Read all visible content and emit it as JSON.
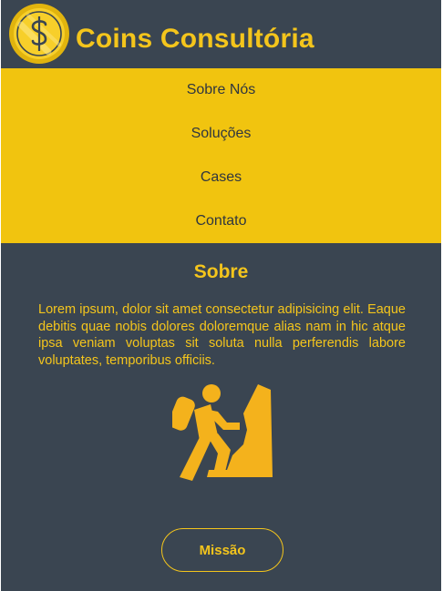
{
  "brand": {
    "name": "Coins Consultória",
    "logo_icon": "dollar-coin-icon"
  },
  "nav": {
    "items": [
      {
        "label": "Sobre Nós"
      },
      {
        "label": "Soluções"
      },
      {
        "label": "Cases"
      },
      {
        "label": "Contato"
      }
    ]
  },
  "about": {
    "title": "Sobre",
    "text": "Lorem ipsum, dolor sit amet consectetur adipisicing elit. Eaque debitis quae nobis dolores doloremque alias nam in hic atque ipsa veniam voluptas sit soluta nulla perferendis labore voluptates, temporibus officiis.",
    "illustration_icon": "person-climbing-icon"
  },
  "mission_button": {
    "label": "Missão"
  },
  "colors": {
    "background": "#3a4551",
    "accent": "#f4c51c",
    "nav_background": "#f1c40f",
    "nav_text": "#2f3640"
  }
}
